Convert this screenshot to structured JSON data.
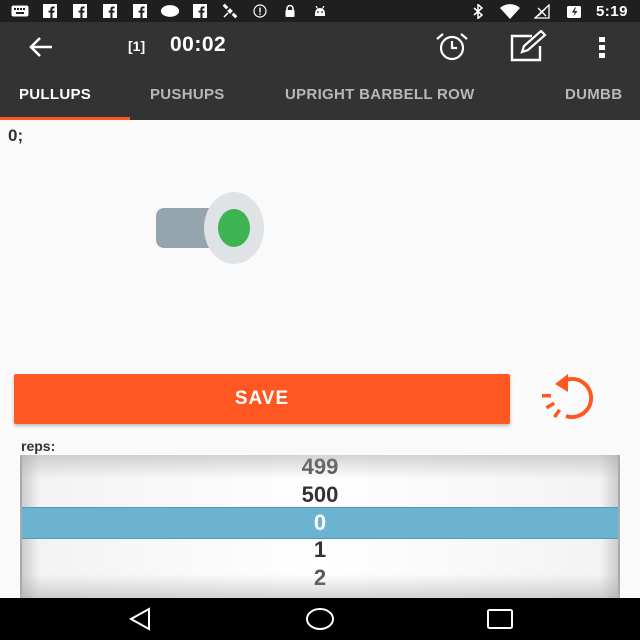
{
  "status_bar": {
    "left_icons": [
      "keyboard-icon",
      "facebook-icon",
      "facebook-icon",
      "facebook-icon",
      "facebook-icon",
      "circle-icon",
      "facebook-icon",
      "satellite-icon",
      "alert-icon",
      "lock-icon",
      "android-icon"
    ],
    "right_icons": [
      "bluetooth-icon",
      "wifi-icon",
      "signal-icon",
      "battery-icon"
    ],
    "time": "5:19"
  },
  "toolbar": {
    "back_icon": "arrow-back-icon",
    "counter": "[1]",
    "timer": "00:02",
    "alarm_icon": "alarm-clock-icon",
    "edit_icon": "edit-icon",
    "menu_icon": "more-vert-icon"
  },
  "tabs": [
    {
      "label": "PULLUPS",
      "active": true
    },
    {
      "label": "PUSHUPS",
      "active": false
    },
    {
      "label": "UPRIGHT BARBELL ROW",
      "active": false
    },
    {
      "label": "DUMBB",
      "active": false
    }
  ],
  "content": {
    "count_text": "0;",
    "save_label": "SAVE",
    "reset_icon": "reset-icon"
  },
  "picker": {
    "label": "reps:",
    "values": [
      "499",
      "500",
      "0",
      "1",
      "2"
    ],
    "selected_index": 2
  },
  "nav_bar": {
    "icons": [
      "back-triangle-icon",
      "home-circle-icon",
      "recents-square-icon"
    ]
  },
  "colors": {
    "accent": "#ff5722",
    "toolbar": "#333333",
    "status_bar": "#1f1f1f",
    "picker_selected": "#6bb3d0",
    "indicator_green": "#3db351"
  }
}
